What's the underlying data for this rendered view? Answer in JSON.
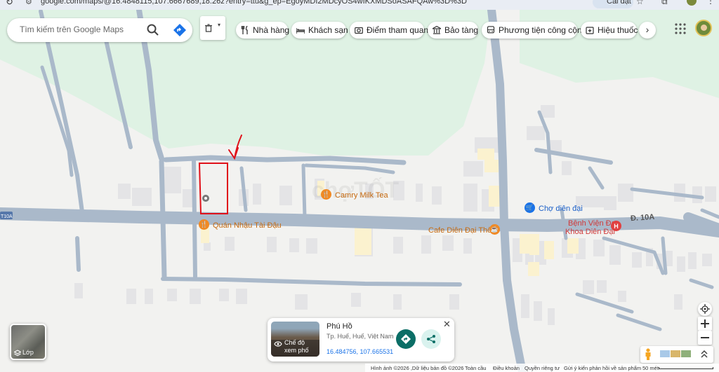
{
  "browser": {
    "url": "google.com/maps/@16.4848115,107.6667689,18.26z?entry=ttu&g_ep=EgoyMDI2MDcyOS4wIKXMDSoASAFQAw%3D%3D",
    "install_label": "Cài đặt"
  },
  "search": {
    "placeholder": "Tìm kiếm trên Google Maps"
  },
  "categories": [
    {
      "label": "Nhà hàng",
      "icon": "fork-knife-icon"
    },
    {
      "label": "Khách sạn",
      "icon": "bed-icon"
    },
    {
      "label": "Điểm tham quan",
      "icon": "camera-icon"
    },
    {
      "label": "Bảo tàng",
      "icon": "museum-icon"
    },
    {
      "label": "Phương tiện công cộng",
      "icon": "bus-icon"
    },
    {
      "label": "Hiệu thuốc",
      "icon": "pharmacy-icon"
    }
  ],
  "pois": {
    "camry": "Camry Milk Tea",
    "quan_nhau": "Quán Nhậu Tài Đậu",
    "cafe": "Cafe Diên Đại Thôn",
    "cho": "Chợ diên đại",
    "benh_vien_1": "Bệnh Viện Đa",
    "benh_vien_2": "Khoa Diên Đại",
    "road_right": "Đ. 10A",
    "road_left": "T10A"
  },
  "watermark": "chợTỐT",
  "place_card": {
    "name": "Phú Hồ",
    "address": "Tp. Huế, Huế, Việt Nam",
    "coordinates": "16.484756, 107.665531",
    "street_view_line1": "Chế độ",
    "street_view_line2": "xem phố"
  },
  "layers_label": "Lớp",
  "footer": {
    "imagery": "Hình ảnh ©2026 ,Dữ liệu bản đồ ©2026",
    "global": "Toàn cầu",
    "terms": "Điều khoản",
    "privacy": "Quyền riêng tư",
    "feedback": "Gửi ý kiến phản hồi về sản phẩm",
    "scale": "50 mét"
  },
  "colors": {
    "green_area": "#dff2e4",
    "road": "#aab9ca",
    "marker_red": "#e0111a",
    "food_orange": "#f08a25",
    "market_blue": "#1a73e8",
    "hospital_red": "#e04040",
    "teal": "#0b6e66"
  }
}
